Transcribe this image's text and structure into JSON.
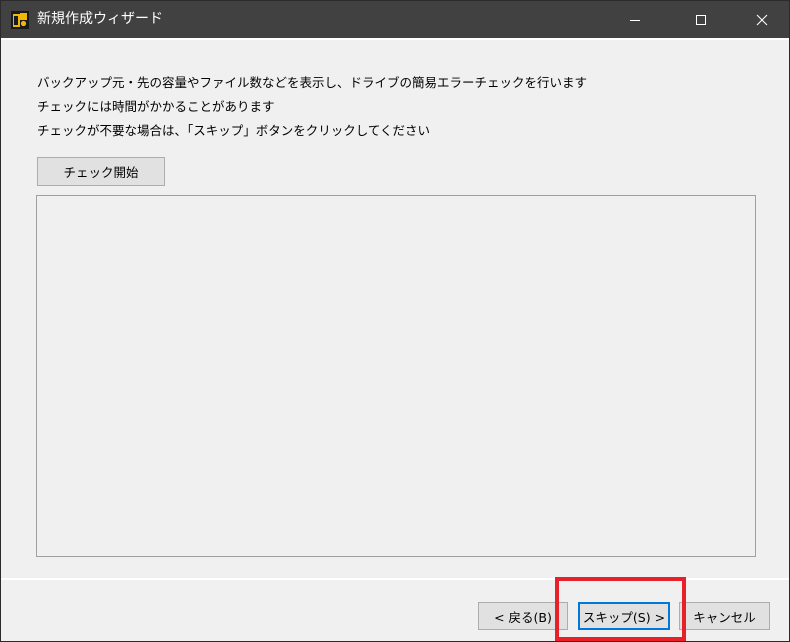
{
  "window": {
    "title": "新規作成ウィザード",
    "icon": "app-logo-icon",
    "controls": [
      "minimize-icon",
      "maximize-icon",
      "close-icon"
    ]
  },
  "content": {
    "description_lines": [
      "バックアップ元・先の容量やファイル数などを表示し、ドライブの簡易エラーチェックを行います",
      "チェックには時間がかかることがあります",
      "チェックが不要な場合は、「スキップ」ボタンをクリックしてください"
    ],
    "check_button_label": "チェック開始"
  },
  "footer": {
    "back_label": "< 戻る(B)",
    "skip_label": "スキップ(S) >",
    "cancel_label": "キャンセル"
  },
  "colors": {
    "titlebar": "#414141",
    "highlight": "#e8202a",
    "focus": "#0078d7"
  }
}
